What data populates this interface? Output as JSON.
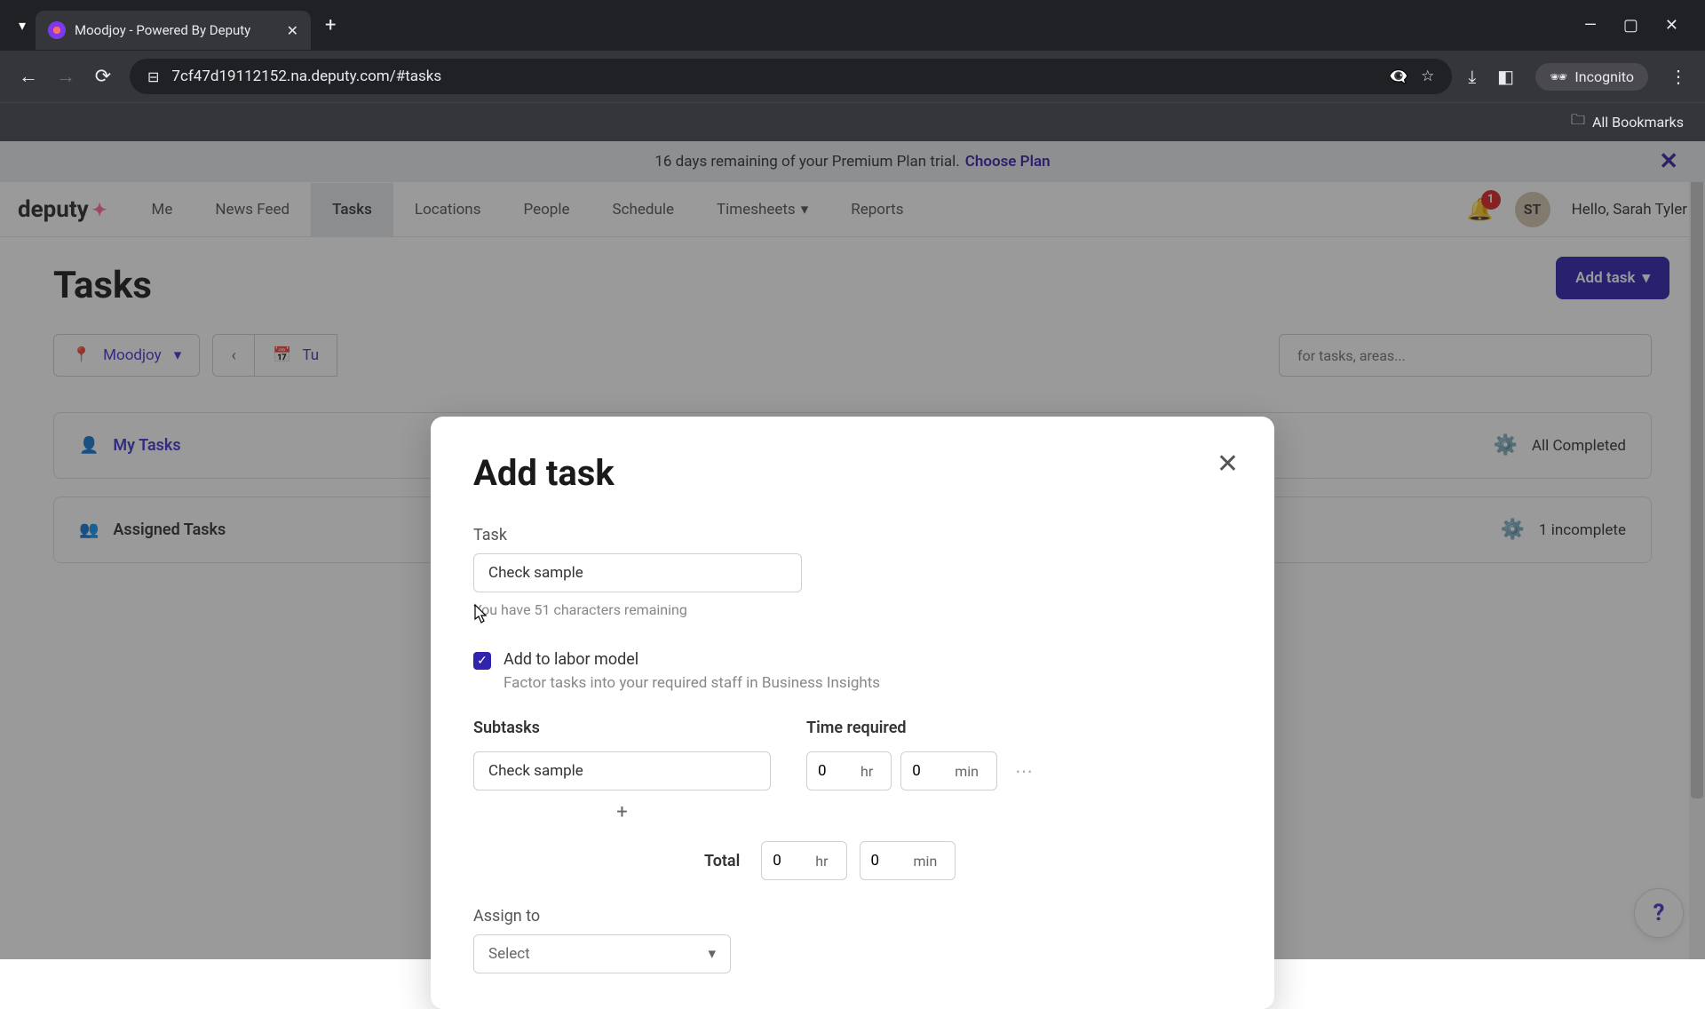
{
  "browser": {
    "tab_title": "Moodjoy - Powered By Deputy",
    "url": "7cf47d19112152.na.deputy.com/#tasks",
    "incognito_label": "Incognito",
    "bookmarks_label": "All Bookmarks"
  },
  "banner": {
    "text": "16 days remaining of your Premium Plan trial.",
    "link": "Choose Plan"
  },
  "nav": {
    "logo": "deputy",
    "items": [
      "Me",
      "News Feed",
      "Tasks",
      "Locations",
      "People",
      "Schedule",
      "Timesheets",
      "Reports"
    ],
    "active_index": 2,
    "bell_count": "1",
    "avatar_initials": "ST",
    "greeting": "Hello, Sarah Tyler"
  },
  "page_header": {
    "title": "Tasks",
    "location": "Moodjoy",
    "date": "Tu",
    "search_placeholder": "for tasks, areas...",
    "add_task_button": "Add task"
  },
  "task_groups": {
    "my_tasks": {
      "label": "My Tasks",
      "status": "All Completed"
    },
    "assigned": {
      "label": "Assigned Tasks",
      "status": "1 incomplete"
    }
  },
  "modal": {
    "title": "Add task",
    "task_label": "Task",
    "task_value": "Check sample",
    "remaining": "You have 51 characters remaining",
    "labor_model_label": "Add to labor model",
    "labor_model_desc": "Factor tasks into your required staff in Business Insights",
    "labor_model_checked": true,
    "subtasks_label": "Subtasks",
    "time_required_label": "Time required",
    "subtask_value": "Check sample",
    "subtask_hr": "0",
    "subtask_min": "0",
    "hr_unit": "hr",
    "min_unit": "min",
    "total_label": "Total",
    "total_hr": "0",
    "total_min": "0",
    "assign_label": "Assign to",
    "assign_value": "Select"
  }
}
